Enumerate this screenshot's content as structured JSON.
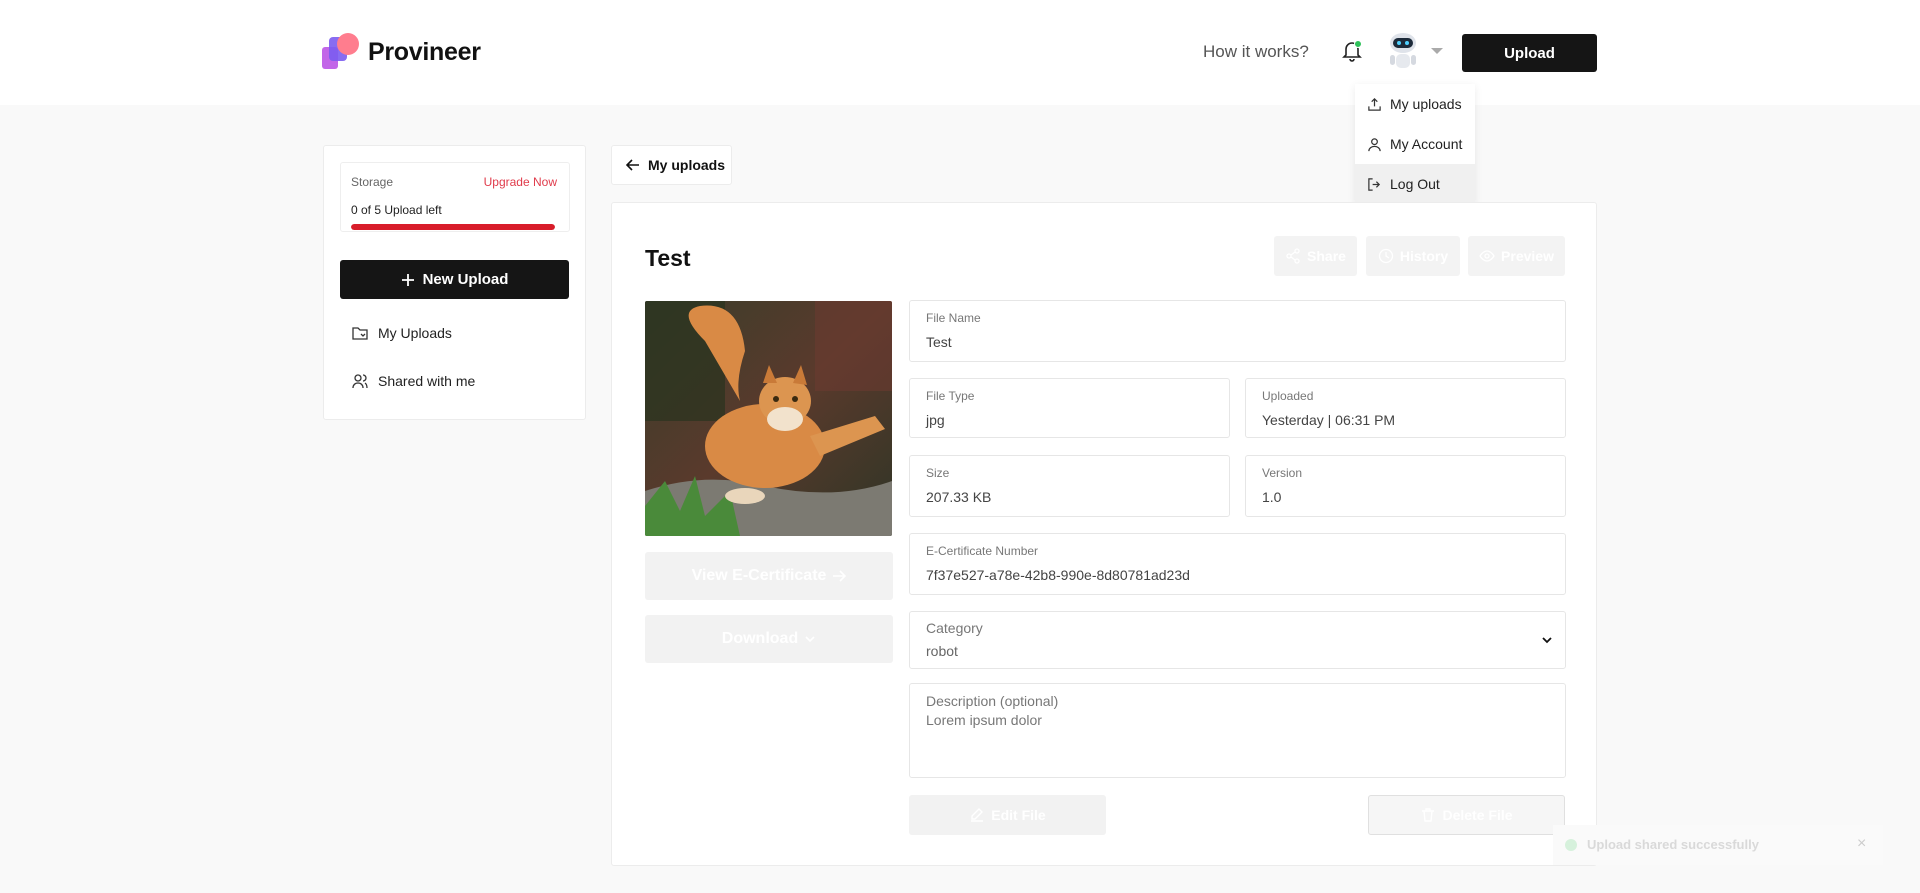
{
  "app": {
    "name": "Provineer"
  },
  "header": {
    "how_it_works": "How it works?",
    "upload_label": "Upload",
    "notification_dot_color": "#2fc15a"
  },
  "user_menu": {
    "items": [
      {
        "label": "My uploads",
        "icon": "upload-icon"
      },
      {
        "label": "My Account",
        "icon": "user-icon"
      },
      {
        "label": "Log Out",
        "icon": "logout-icon"
      }
    ]
  },
  "sidebar": {
    "storage_label": "Storage",
    "upgrade_label": "Upgrade Now",
    "uploads_left": "0 of 5 Upload left",
    "storage_used_fraction": 1.0,
    "new_upload_label": "New Upload",
    "nav": [
      {
        "label": "My Uploads",
        "icon": "folder-icon"
      },
      {
        "label": "Shared with me",
        "icon": "users-icon"
      }
    ]
  },
  "back": {
    "label": "My uploads"
  },
  "file": {
    "title": "Test",
    "actions": {
      "share": "Share",
      "history": "History",
      "preview": "Preview"
    },
    "view_certificate": "View E-Certificate",
    "download": "Download",
    "fields": {
      "file_name": {
        "label": "File Name",
        "value": "Test"
      },
      "file_type": {
        "label": "File Type",
        "value": "jpg"
      },
      "uploaded": {
        "label": "Uploaded",
        "value": "Yesterday | 06:31 PM"
      },
      "size": {
        "label": "Size",
        "value": "207.33 KB"
      },
      "version": {
        "label": "Version",
        "value": "1.0"
      },
      "certificate": {
        "label": "E-Certificate Number",
        "value": "7f37e527-a78e-42b8-990e-8d80781ad23d"
      },
      "category": {
        "label": "Category",
        "value": "robot"
      },
      "description": {
        "label": "Description (optional)",
        "value": "Lorem ipsum dolor"
      }
    },
    "edit_label": "Edit File",
    "delete_label": "Delete File"
  },
  "toast": {
    "message": "Upload shared successfully",
    "close": "×"
  },
  "colors": {
    "accent_dark": "#151515",
    "danger": "#d81d2a",
    "upgrade": "#e03b4b"
  }
}
